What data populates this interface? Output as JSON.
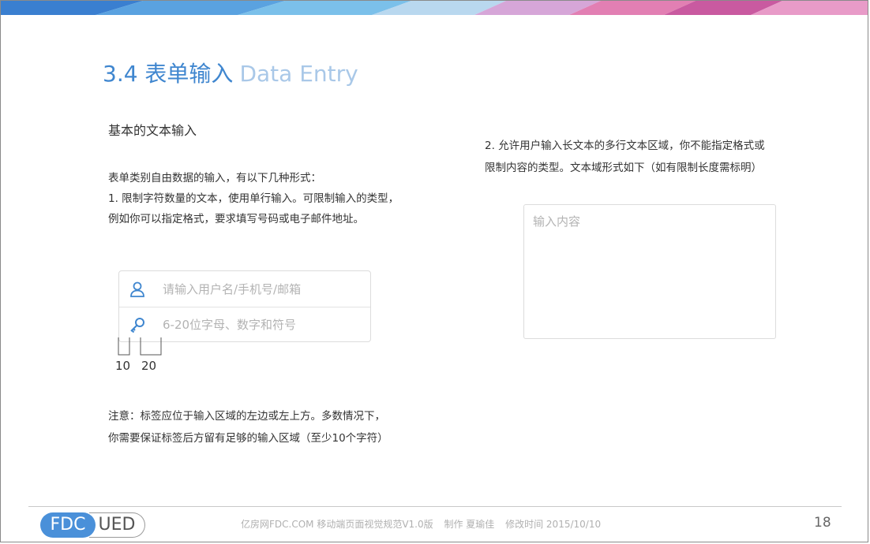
{
  "slide": {
    "title_cn": "3.4 表单输入",
    "title_en": "Data Entry",
    "section_heading": "基本的文本输入",
    "left_paragraph": {
      "line1": "表单类别自由数据的输入，有以下几种形式：",
      "line2": "1. 限制字符数量的文本，使用单行输入。可限制输入的类型，",
      "line3": "例如你可以指定格式，要求填写号码或电子邮件地址。"
    },
    "right_paragraph": {
      "line1": "2. 允许用户输入长文本的多行文本区域，你不能指定格式或",
      "line2": "限制内容的类型。文本域形式如下（如有限制长度需标明）"
    },
    "login_form": {
      "username_placeholder": "请输入用户名/手机号/邮箱",
      "password_placeholder": "6-20位字母、数字和符号"
    },
    "dimensions": {
      "first": "10",
      "second": "20"
    },
    "textarea_placeholder": "输入内容",
    "note": {
      "line1": "注意：标签应位于输入区域的左边或左上方。多数情况下，",
      "line2": "你需要保证标签后方留有足够的输入区域（至少10个字符）"
    },
    "footer": {
      "logo_left": "FDC",
      "logo_right": "UED",
      "site": "亿房网FDC.COM 移动端页面视觉规范V1.0版",
      "author": "制作 夏瑜佳",
      "modified": "修改时间  2015/10/10",
      "page_number": "18"
    },
    "colors": {
      "title_blue": "#3f86cf",
      "title_light": "#a9c8e8",
      "icon_blue": "#3f86cf"
    }
  }
}
